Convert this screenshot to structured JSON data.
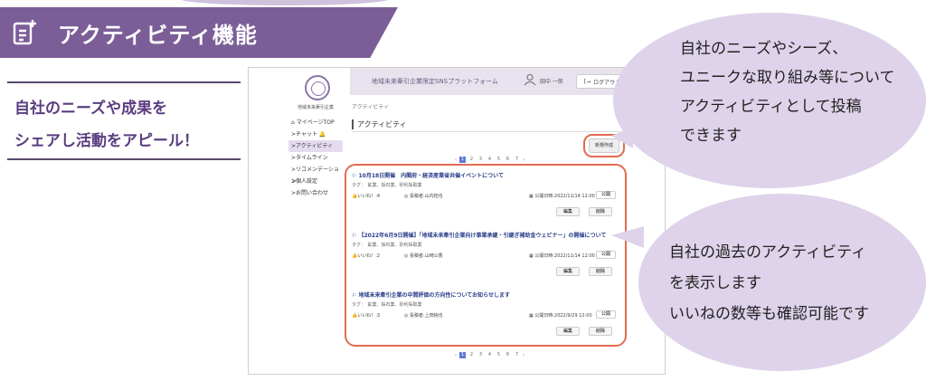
{
  "banner": {
    "title": "アクティビティ機能",
    "icon": "document-add-icon"
  },
  "left_caption": {
    "line1": "自社のニーズや成果を",
    "line2": "シェアし活動をアピール！"
  },
  "app": {
    "logo_text": "地域未来牽引企業",
    "topbar_title": "地域未来牽引企業限定SNSプラットフォーム",
    "user_name": "田中 一郎",
    "logout": "ログアウト",
    "breadcrumb": "アクティビティ",
    "menu": [
      {
        "label": "マイページTOP",
        "icon": "home-icon"
      },
      {
        "label": "チャット",
        "icon": "bell-icon"
      },
      {
        "label": "アクティビティ"
      },
      {
        "label": "タイムライン"
      },
      {
        "label": "リコメンデーション"
      },
      {
        "label": "個人設定"
      },
      {
        "label": "お問い合わせ"
      }
    ],
    "heading": "アクティビティ",
    "new_button": "新規作成",
    "pages": [
      "1",
      "2",
      "3",
      "4",
      "5",
      "6",
      "7"
    ],
    "current_page": "1",
    "cards": [
      {
        "title": "10月18日開催　内閣府・経済産業省共催イベントについて",
        "tags": "タグ：　鉱業、採石業、砂利採取業",
        "likes": "いいね！:4",
        "poster": "投稿者:山内拓也",
        "date": "公開日時:2022/11/14 12:00",
        "status": "公開",
        "edit": "編集",
        "delete": "削除"
      },
      {
        "title": "【2022年6月9日開催】「地域未来牽引企業向け事業承継・引継ぎ補助金ウェビナー」の開催について",
        "tags": "タグ：　鉱業、採石業、砂利採取業",
        "likes": "いいね！:2",
        "poster": "投稿者:山崎公香",
        "date": "公開日時:2022/11/14 12:00",
        "status": "公開",
        "edit": "編集",
        "delete": "削除"
      },
      {
        "title": "地域未来牽引企業の中間評価の方向性についてお知らせします",
        "tags": "タグ：　鉱業、採石業、砂利採取業",
        "likes": "いいね！:3",
        "poster": "投稿者:上田純也",
        "date": "公開日時:2022/9/29 12:00",
        "status": "公開",
        "edit": "編集",
        "delete": "削除"
      }
    ]
  },
  "bubble1": {
    "lines": [
      "自社のニーズやシーズ、",
      "ユニークな取り組み等について",
      "アクティビティとして投稿",
      "できます"
    ]
  },
  "bubble2": {
    "lines": [
      "自社の過去のアクティビティ",
      "を表示します",
      "いいねの数等も確認可能です"
    ]
  },
  "colors": {
    "banner": "#7b5e98",
    "highlight": "#e26b50",
    "bubble": "#ded3ea",
    "caption": "#5b3d80"
  }
}
